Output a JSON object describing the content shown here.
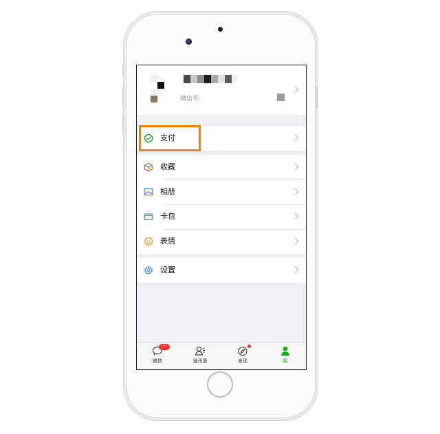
{
  "profile": {
    "wechat_id_label": "微信号:"
  },
  "menu": {
    "pay": {
      "label": "支付",
      "icon": "wallet-check-icon"
    },
    "favorites": {
      "label": "收藏",
      "icon": "cube-icon"
    },
    "album": {
      "label": "相册",
      "icon": "photo-icon"
    },
    "cards": {
      "label": "卡包",
      "icon": "card-icon"
    },
    "stickers": {
      "label": "表情",
      "icon": "smiley-icon"
    },
    "settings": {
      "label": "设置",
      "icon": "gear-icon"
    }
  },
  "tabbar": {
    "chats": {
      "label": "微信",
      "badge": "···"
    },
    "contacts": {
      "label": "通讯录"
    },
    "discover": {
      "label": "发现"
    },
    "me": {
      "label": "我"
    }
  },
  "colors": {
    "highlight": "#f0801a",
    "wechat_green": "#1aad19",
    "badge_red": "#f43530"
  }
}
